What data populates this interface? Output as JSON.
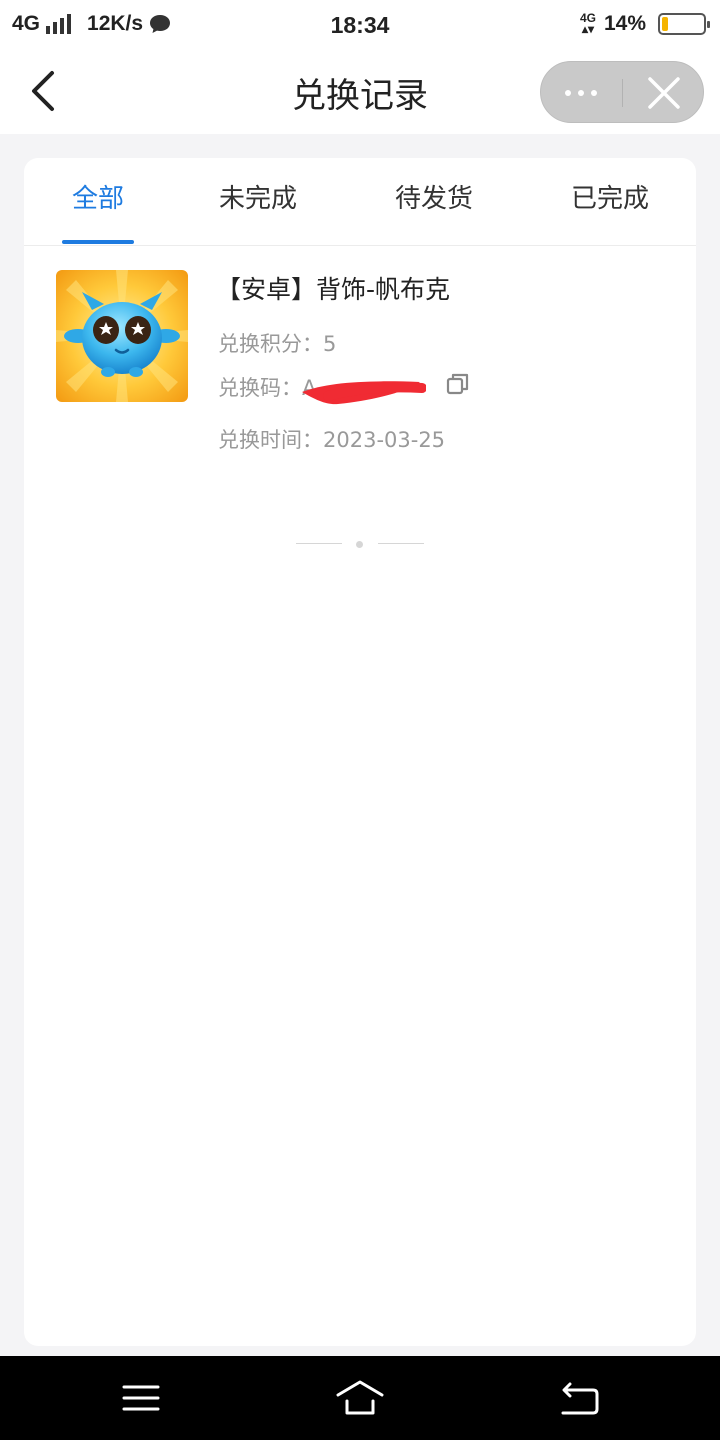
{
  "status_bar": {
    "network": "4G",
    "speed": "12K/s",
    "time": "18:34",
    "mobile_data_label": "4G",
    "battery_text": "14%",
    "battery_level": 0.14,
    "icons": [
      "signal-icon",
      "message-icon",
      "mobile-data-icon",
      "battery-icon"
    ]
  },
  "header": {
    "title": "兑换记录",
    "icons": [
      "back-arrow-icon",
      "more-dots-icon",
      "close-icon"
    ]
  },
  "tabs": [
    {
      "label": "全部",
      "active": true
    },
    {
      "label": "未完成",
      "active": false
    },
    {
      "label": "待发货",
      "active": false
    },
    {
      "label": "已完成",
      "active": false
    }
  ],
  "records": [
    {
      "title": "【安卓】背饰-帆布克",
      "points_label": "兑换积分：",
      "points": "5",
      "code_label": "兑换码：",
      "code": "A",
      "time_label": "兑换时间：",
      "time": "2023-03-25",
      "image_icon": "blue-monster-icon",
      "copy_icon": "copy-icon"
    }
  ],
  "colors": {
    "accent": "#1e7be0",
    "muted_text": "#999999",
    "page_bg": "#f4f4f6",
    "battery_fill": "#f5b400",
    "redaction": "#f02b33"
  },
  "nav_bar": {
    "icons": [
      "menu-icon",
      "home-icon",
      "back-icon"
    ]
  }
}
